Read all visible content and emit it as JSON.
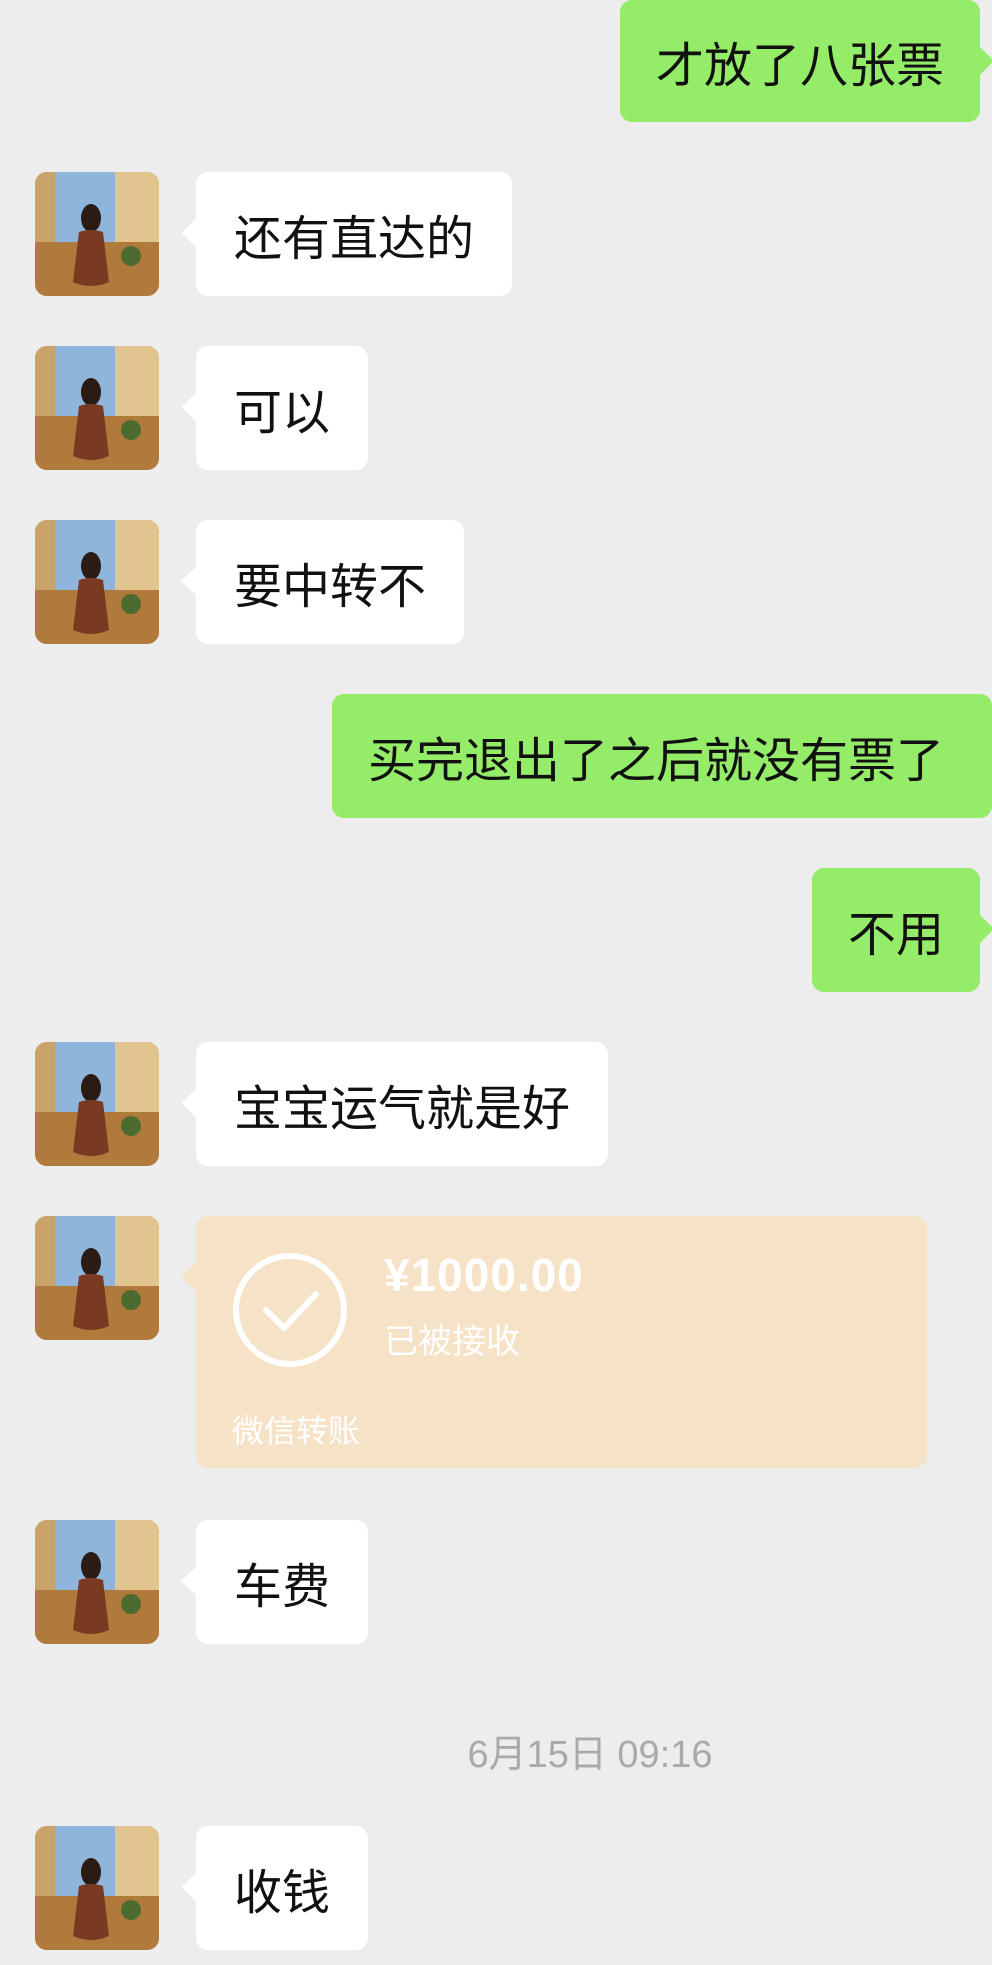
{
  "messages": {
    "m1": "才放了八张票",
    "m2": "还有直达的",
    "m3": "可以",
    "m4": "要中转不",
    "m5": "买完退出了之后就没有票了",
    "m6": "不用",
    "m7": "宝宝运气就是好",
    "m8": "车费",
    "m9": "收钱"
  },
  "transfer": {
    "amount": "¥1000.00",
    "status": "已被接收",
    "label": "微信转账"
  },
  "timestamp": "6月15日 09:16",
  "colors": {
    "background": "#ededed",
    "outgoing_bubble": "#95ec69",
    "incoming_bubble": "#ffffff",
    "transfer_card": "#f6e2c6",
    "timestamp_text": "#a9a9a9"
  },
  "icons": {
    "avatar": "contact-avatar-photo",
    "transfer_status": "check-circle-icon"
  }
}
